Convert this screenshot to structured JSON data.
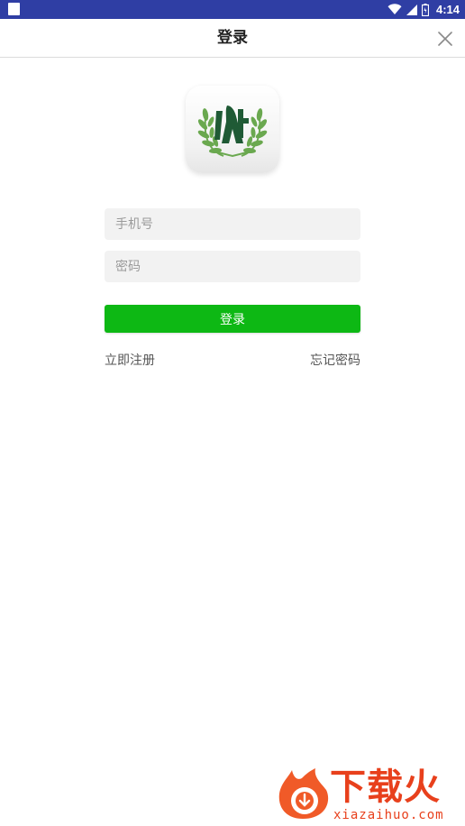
{
  "status_bar": {
    "time": "4:14",
    "background_color": "#2f3ea4",
    "icons": [
      "app-notification-icon",
      "wifi-icon",
      "signal-icon",
      "battery-icon"
    ]
  },
  "header": {
    "title": "登录",
    "close_icon": "close-icon"
  },
  "logo": {
    "icon": "laurel-logo-icon",
    "colors": {
      "leaf": "#6aa84f",
      "mark": "#1f5a35"
    }
  },
  "form": {
    "phone_placeholder": "手机号",
    "phone_value": "",
    "password_placeholder": "密码",
    "password_value": "",
    "login_label": "登录",
    "login_color": "#0db814"
  },
  "links": {
    "register": "立即注册",
    "forgot_password": "忘记密码"
  },
  "watermark": {
    "brand": "下载火",
    "url": "xiazaihuo.com",
    "color": "#e8401c"
  }
}
